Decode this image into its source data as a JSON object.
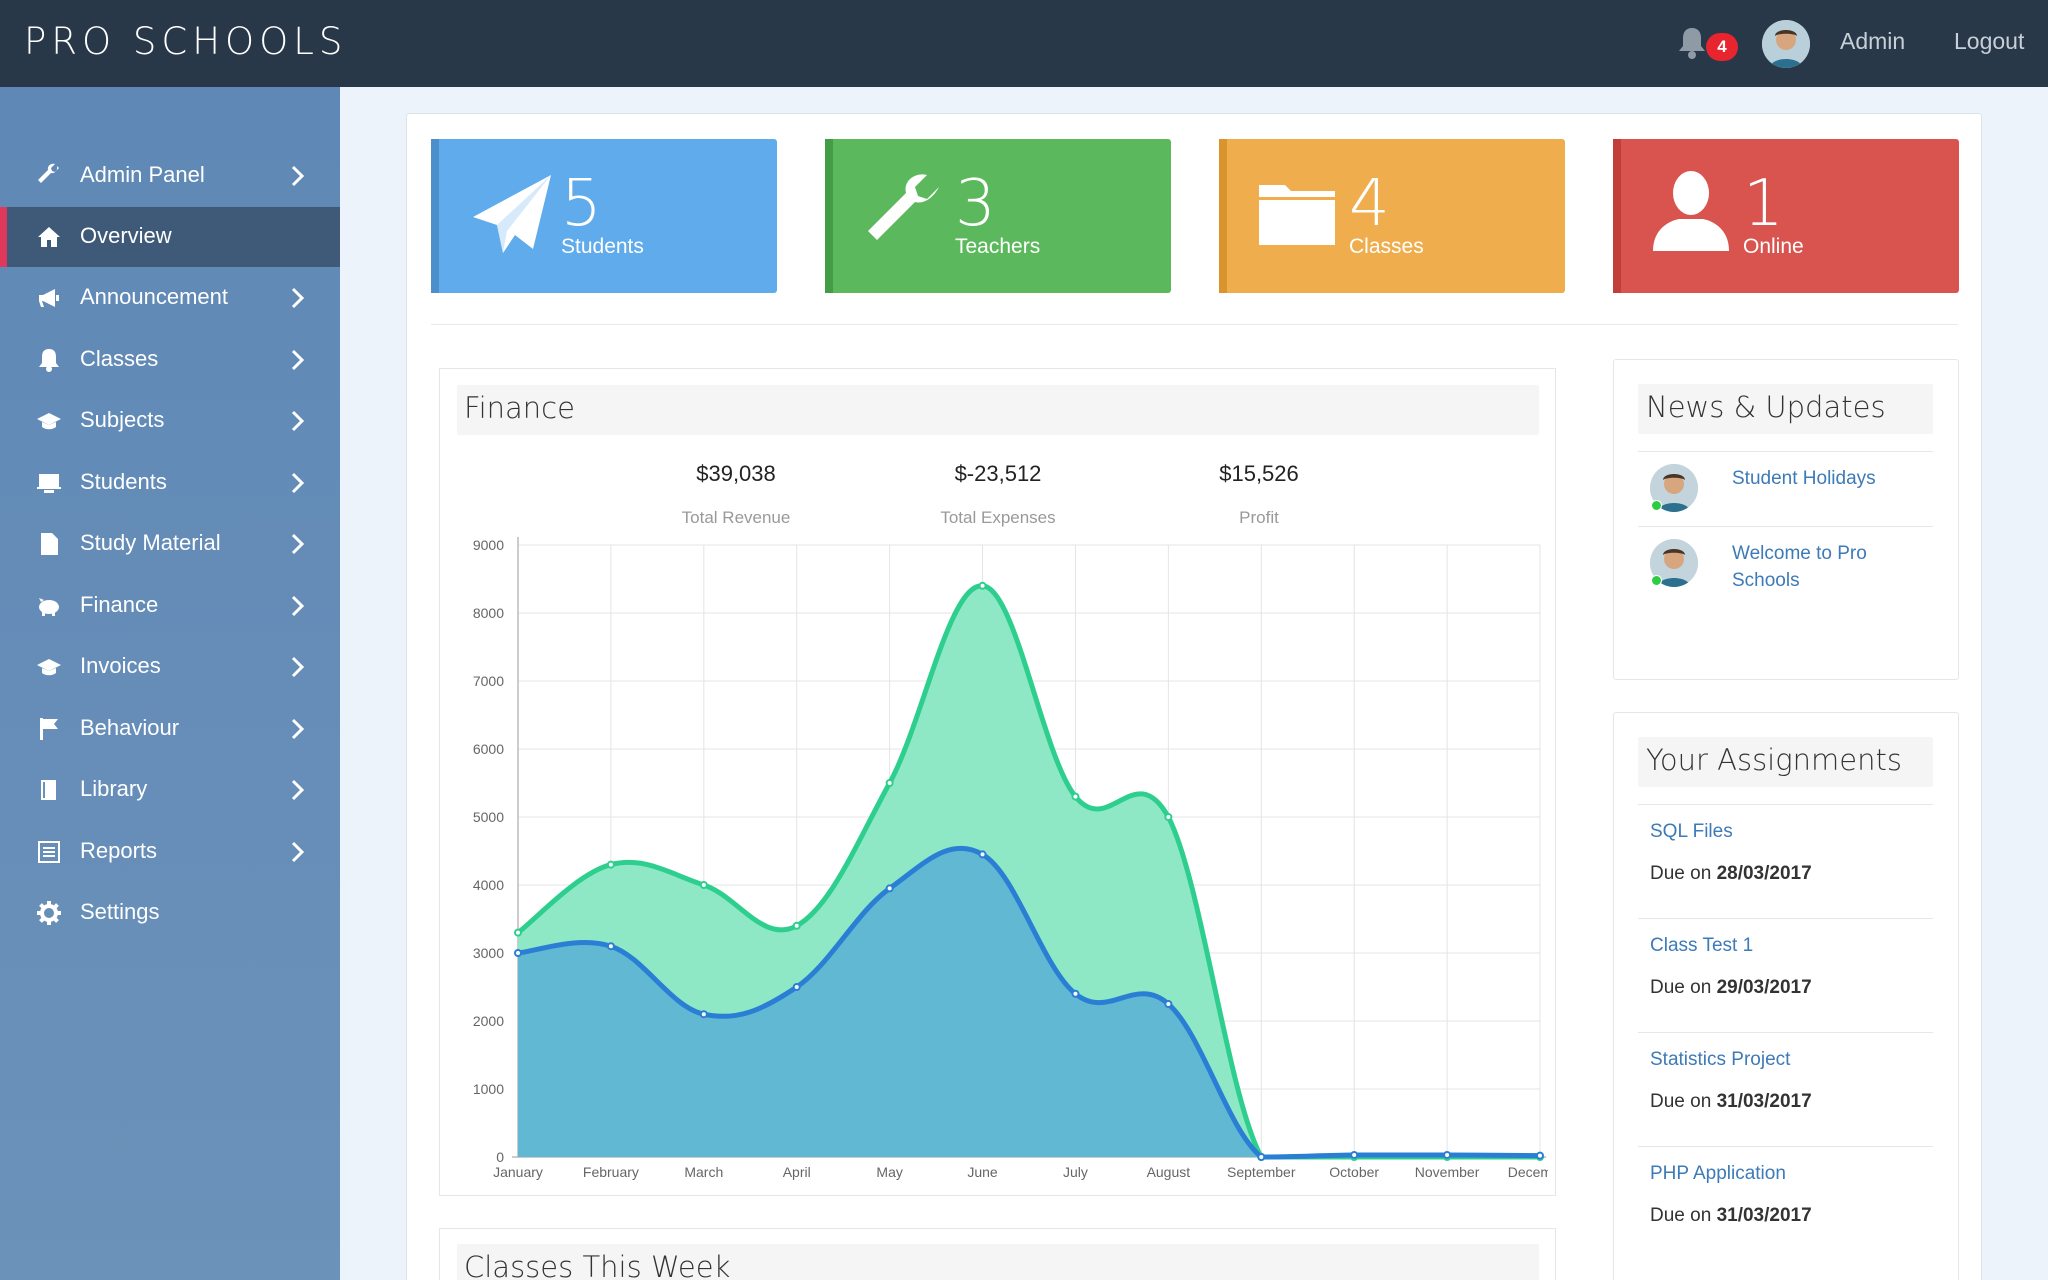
{
  "header": {
    "brand": "PRO SCHOOLS",
    "notification_count": "4",
    "user": "Admin",
    "logout": "Logout"
  },
  "sidebar": {
    "items": [
      {
        "label": "Admin Panel",
        "icon": "wrench-icon"
      },
      {
        "label": "Overview",
        "icon": "home-icon"
      },
      {
        "label": "Announcement",
        "icon": "megaphone-icon"
      },
      {
        "label": "Classes",
        "icon": "bell-icon"
      },
      {
        "label": "Subjects",
        "icon": "graduation-cap-icon"
      },
      {
        "label": "Students",
        "icon": "presentation-icon"
      },
      {
        "label": "Study Material",
        "icon": "file-icon"
      },
      {
        "label": "Finance",
        "icon": "piggy-bank-icon"
      },
      {
        "label": "Invoices",
        "icon": "graduation-cap-icon"
      },
      {
        "label": "Behaviour",
        "icon": "flag-icon"
      },
      {
        "label": "Library",
        "icon": "book-icon"
      },
      {
        "label": "Reports",
        "icon": "list-icon"
      },
      {
        "label": "Settings",
        "icon": "gear-icon"
      }
    ]
  },
  "stats": [
    {
      "value": "5",
      "label": "Students",
      "color": "#5fabeb",
      "icon": "paper-plane-icon"
    },
    {
      "value": "3",
      "label": "Teachers",
      "color": "#5cb85c",
      "icon": "wrench-icon"
    },
    {
      "value": "4",
      "label": "Classes",
      "color": "#f0ad4e",
      "icon": "folder-icon"
    },
    {
      "value": "1",
      "label": "Online",
      "color": "#d9534f",
      "icon": "user-icon"
    }
  ],
  "finance": {
    "title": "Finance",
    "revenue_value": "$39,038",
    "revenue_label": "Total Revenue",
    "expenses_value": "$-23,512",
    "expenses_label": "Total Expenses",
    "profit_value": "$15,526",
    "profit_label": "Profit"
  },
  "chart_data": {
    "type": "area",
    "categories": [
      "January",
      "February",
      "March",
      "April",
      "May",
      "June",
      "July",
      "August",
      "September",
      "October",
      "November",
      "December"
    ],
    "ylim": [
      0,
      9000
    ],
    "yticks": [
      "0",
      "1000",
      "2000",
      "3000",
      "4000",
      "5000",
      "6000",
      "7000",
      "8000",
      "9000"
    ],
    "series": [
      {
        "values": [
          3300,
          4300,
          4000,
          3400,
          5500,
          8400,
          5300,
          5000,
          0,
          0,
          0,
          0
        ],
        "color": "#2ecf8e",
        "fill": "#8ee8c5"
      },
      {
        "values": [
          3000,
          3100,
          2100,
          2500,
          3950,
          4450,
          2400,
          2250,
          0,
          30,
          30,
          20
        ],
        "color": "#2a7fd4",
        "fill": "#5fb5d4"
      }
    ],
    "grid": true
  },
  "classes_week": {
    "title": "Classes This Week"
  },
  "news": {
    "title": "News & Updates",
    "items": [
      {
        "title": "Student Holidays"
      },
      {
        "title": "Welcome to Pro Schools"
      }
    ]
  },
  "assignments": {
    "title": "Your Assignments",
    "due_prefix": "Due on",
    "items": [
      {
        "title": "SQL Files",
        "due": "28/03/2017"
      },
      {
        "title": "Class Test 1",
        "due": "29/03/2017"
      },
      {
        "title": "Statistics Project",
        "due": "31/03/2017"
      },
      {
        "title": "PHP Application",
        "due": "31/03/2017"
      }
    ]
  }
}
